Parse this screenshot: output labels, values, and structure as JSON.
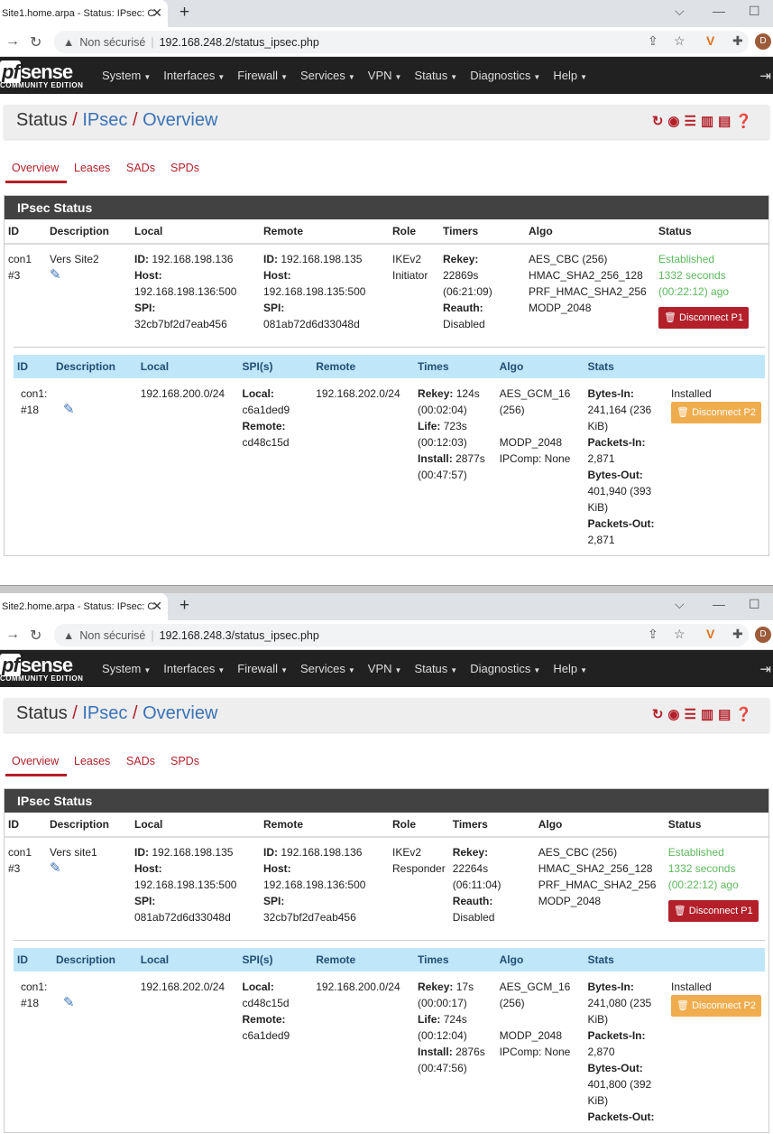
{
  "windows": [
    {
      "tab_title": "Site1.home.arpa - Status: IPsec: C",
      "insecure_label": "Non sécurisé",
      "url": "192.168.248.2/status_ipsec.php",
      "menu": [
        "System",
        "Interfaces",
        "Firewall",
        "Services",
        "VPN",
        "Status",
        "Diagnostics",
        "Help"
      ],
      "breadcrumb": {
        "root": "Status",
        "mid": "IPsec",
        "leaf": "Overview"
      },
      "tabs": [
        "Overview",
        "Leases",
        "SADs",
        "SPDs"
      ],
      "panel_title": "IPsec Status",
      "p1_headers": [
        "ID",
        "Description",
        "Local",
        "Remote",
        "Role",
        "Timers",
        "Algo",
        "Status"
      ],
      "p1": {
        "id1": "con1",
        "id2": "#3",
        "description": "Vers Site2",
        "local_id": "192.168.198.136",
        "local_host": "192.168.198.136:500",
        "local_spi": "32cb7bf2d7eab456",
        "remote_id": "192.168.198.135",
        "remote_host": "192.168.198.135:500",
        "remote_spi": "081ab72d6d33048d",
        "role1": "IKEv2",
        "role2": "Initiator",
        "rekey": "22869s",
        "rekey_t": "(06:21:09)",
        "reauth": "Disabled",
        "algo": [
          "AES_CBC (256)",
          "HMAC_SHA2_256_128",
          "PRF_HMAC_SHA2_256",
          "MODP_2048"
        ],
        "status1": "Established",
        "status2": "1332 seconds",
        "status3": "(00:22:12) ago",
        "disconnect": "Disconnect P1"
      },
      "p2_headers": [
        "ID",
        "Description",
        "Local",
        "SPI(s)",
        "Remote",
        "Times",
        "Algo",
        "Stats"
      ],
      "p2": {
        "id1": "con1:",
        "id2": "#18",
        "local": "192.168.200.0/24",
        "spi_local": "c6a1ded9",
        "spi_remote": "cd48c15d",
        "remote": "192.168.202.0/24",
        "rekey": "124s",
        "rekey_t": "(00:02:04)",
        "life": "723s",
        "life_t": "(00:12:03)",
        "install": "2877s",
        "install_t": "(00:47:57)",
        "algo1": "AES_GCM_16",
        "algo2": "(256)",
        "algo3": "MODP_2048",
        "algo4": "IPComp: None",
        "bytes_in": "241,164 (236",
        "bytes_in2": "KiB)",
        "packets_in": "2,871",
        "bytes_out": "401,940 (393",
        "bytes_out2": "KiB)",
        "packets_out": "2,871",
        "state": "Installed",
        "disconnect": "Disconnect P2"
      }
    },
    {
      "tab_title": "Site2.home.arpa - Status: IPsec: C",
      "insecure_label": "Non sécurisé",
      "url": "192.168.248.3/status_ipsec.php",
      "menu": [
        "System",
        "Interfaces",
        "Firewall",
        "Services",
        "VPN",
        "Status",
        "Diagnostics",
        "Help"
      ],
      "breadcrumb": {
        "root": "Status",
        "mid": "IPsec",
        "leaf": "Overview"
      },
      "tabs": [
        "Overview",
        "Leases",
        "SADs",
        "SPDs"
      ],
      "panel_title": "IPsec Status",
      "p1_headers": [
        "ID",
        "Description",
        "Local",
        "Remote",
        "Role",
        "Timers",
        "Algo",
        "Status"
      ],
      "p1": {
        "id1": "con1",
        "id2": "#3",
        "description": "Vers site1",
        "local_id": "192.168.198.135",
        "local_host": "192.168.198.135:500",
        "local_spi": "081ab72d6d33048d",
        "remote_id": "192.168.198.136",
        "remote_host": "192.168.198.136:500",
        "remote_spi": "32cb7bf2d7eab456",
        "role1": "IKEv2",
        "role2": "Responder",
        "rekey": "22264s",
        "rekey_t": "(06:11:04)",
        "reauth": "Disabled",
        "algo": [
          "AES_CBC (256)",
          "HMAC_SHA2_256_128",
          "PRF_HMAC_SHA2_256",
          "MODP_2048"
        ],
        "status1": "Established",
        "status2": "1332 seconds",
        "status3": "(00:22:12) ago",
        "disconnect": "Disconnect P1"
      },
      "p2_headers": [
        "ID",
        "Description",
        "Local",
        "SPI(s)",
        "Remote",
        "Times",
        "Algo",
        "Stats"
      ],
      "p2": {
        "id1": "con1:",
        "id2": "#18",
        "local": "192.168.202.0/24",
        "spi_local": "cd48c15d",
        "spi_remote": "c6a1ded9",
        "remote": "192.168.200.0/24",
        "rekey": "17s",
        "rekey_t": "(00:00:17)",
        "life": "724s",
        "life_t": "(00:12:04)",
        "install": "2876s",
        "install_t": "(00:47:56)",
        "algo1": "AES_GCM_16",
        "algo2": "(256)",
        "algo3": "MODP_2048",
        "algo4": "IPComp: None",
        "bytes_in": "241,080 (235",
        "bytes_in2": "KiB)",
        "packets_in": "2,870",
        "bytes_out": "401,800 (392",
        "bytes_out2": "KiB)",
        "packets_out": "",
        "state": "Installed",
        "disconnect": "Disconnect P2"
      }
    }
  ],
  "labels": {
    "id": "ID:",
    "host": "Host:",
    "spi": "SPI:",
    "rekey": "Rekey:",
    "reauth": "Reauth:",
    "life": "Life:",
    "install": "Install:",
    "local": "Local:",
    "remote": "Remote:",
    "bytes_in": "Bytes-In:",
    "packets_in": "Packets-In:",
    "bytes_out": "Bytes-Out:",
    "packets_out": "Packets-Out:",
    "logo_pf": "pf",
    "logo_sense": "sense",
    "logo_ce": "COMMUNITY EDITION",
    "avatar": "D"
  }
}
